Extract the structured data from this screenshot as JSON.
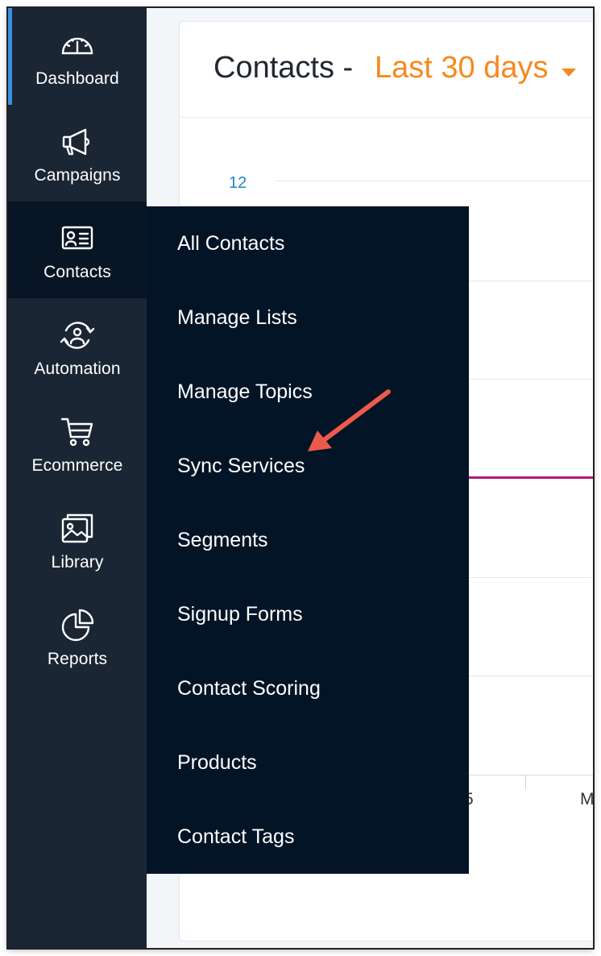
{
  "sidebar": {
    "items": [
      {
        "label": "Dashboard",
        "icon": "dashboard-gauge-icon"
      },
      {
        "label": "Campaigns",
        "icon": "megaphone-icon"
      },
      {
        "label": "Contacts",
        "icon": "contact-card-icon"
      },
      {
        "label": "Automation",
        "icon": "automation-person-icon"
      },
      {
        "label": "Ecommerce",
        "icon": "shopping-cart-icon"
      },
      {
        "label": "Library",
        "icon": "image-library-icon"
      },
      {
        "label": "Reports",
        "icon": "pie-chart-icon"
      }
    ]
  },
  "header": {
    "title": "Contacts -",
    "range": "Last 30 days"
  },
  "chart": {
    "y_tick": "12",
    "x_labels": [
      "5",
      "M"
    ]
  },
  "contacts_menu": {
    "items": [
      "All Contacts",
      "Manage Lists",
      "Manage Topics",
      "Sync Services",
      "Segments",
      "Signup Forms",
      "Contact Scoring",
      "Products",
      "Contact Tags"
    ]
  },
  "colors": {
    "sidebar_bg": "#1b2634",
    "menu_bg": "#031426",
    "accent_orange": "#f5891f",
    "active_indicator": "#3d8fe0",
    "series_line": "#b0197e",
    "annotation_arrow": "#ee5a4a"
  }
}
